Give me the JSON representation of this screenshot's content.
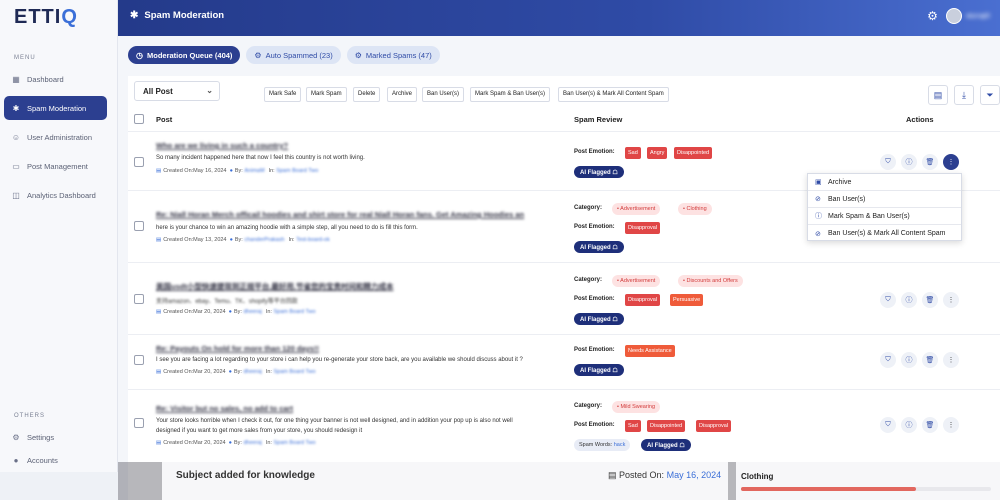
{
  "app": {
    "logo_text": "ETTI",
    "logo_accent": "Q",
    "brand_color": "#2c3f90"
  },
  "sidebar": {
    "menu_label": "MENU",
    "items": [
      {
        "label": "Dashboard",
        "icon": "dashboard-icon"
      },
      {
        "label": "Spam Moderation",
        "icon": "bug-icon",
        "active": true
      },
      {
        "label": "User Administration",
        "icon": "users-icon"
      },
      {
        "label": "Post Management",
        "icon": "post-icon"
      },
      {
        "label": "Analytics Dashboard",
        "icon": "analytics-icon"
      }
    ],
    "others_label": "OTHERS",
    "others": [
      {
        "label": "Settings",
        "icon": "gear-icon"
      },
      {
        "label": "Accounts",
        "icon": "person-icon"
      }
    ]
  },
  "header": {
    "title": "Spam Moderation",
    "username": "sbzrajl0"
  },
  "tabs": [
    {
      "label": "Moderation Queue (404)",
      "active": true
    },
    {
      "label": "Auto Spammed (23)"
    },
    {
      "label": "Marked Spams (47)"
    }
  ],
  "toolbar": {
    "filter_select": "All Post",
    "actions": [
      "Mark Safe",
      "Mark Spam",
      "Delete",
      "Archive",
      "Ban User(s)",
      "Mark Spam & Ban User(s)",
      "Ban User(s) & Mark All Content Spam"
    ]
  },
  "table": {
    "headers": {
      "post": "Post",
      "review": "Spam Review",
      "actions": "Actions"
    },
    "rows": [
      {
        "title": "Who are we living in such a country?",
        "body": "So many incident happened here that now I feel this country is not worth living.",
        "created": "Created On:May 16, 2024",
        "by_label": "By:",
        "by": "AnimaM",
        "in_label": "In:",
        "board": "Spam Board Two",
        "emotion_label": "Post Emotion:",
        "emotions": [
          "Sad",
          "Angry",
          "Disappointed"
        ],
        "ai": "AI Flagged"
      },
      {
        "title": "Re: Niall Horan Merch officail hoodies and shirt store for real Niall Horan fans. Get Amazing Hoodies an",
        "body": "here is your chance to win an amazing hoodie with a simple step, all you need to do is fill this form.",
        "created": "Created On:May 13, 2024",
        "by_label": "By:",
        "by": "chanderPrakash",
        "in_label": "In:",
        "board": "Test-board-ok",
        "category_label": "Category:",
        "categories": [
          "Advertisement",
          "Clothing"
        ],
        "emotion_label": "Post Emotion:",
        "emotions": [
          "Disapproval"
        ],
        "ai": "AI Flagged"
      },
      {
        "title": "美国usdt小型快速提现到正规平台,最好用,节省您的宝贵时间和精力成本",
        "body": "支持amazon、ebay、Temu、TK、shopify等平台回款",
        "created": "Created On:Mar 20, 2024",
        "by_label": "By:",
        "by": "dheeraj",
        "in_label": "In:",
        "board": "Spam Board Two",
        "category_label": "Category:",
        "categories": [
          "Advertisement",
          "Discounts and Offers"
        ],
        "emotion_label": "Post Emotion:",
        "emotions": [
          "Disapproval",
          "Persuasive"
        ],
        "ai": "AI Flagged"
      },
      {
        "title": "Re: Payouts On hold for more than 120 days!!",
        "body": "I see you are facing a lot regarding to your store i can help you re-generate your store back, are you available we should discuss about it ?",
        "created": "Created On:Mar 20, 2024",
        "by_label": "By:",
        "by": "dheeraj",
        "in_label": "In:",
        "board": "Spam Board Two",
        "emotion_label": "Post Emotion:",
        "emotions": [
          "Needs Assistance"
        ],
        "ai": "AI Flagged"
      },
      {
        "title": "Re: Visitor but no sales, no add to cart",
        "body": "Your store looks horrible when I check it out, for one thing your banner is not well designed, and in addition your pop up is also not well",
        "body2": "designed if you want to get more sales from your store, you should redesign it",
        "created": "Created On:Mar 20, 2024",
        "by_label": "By:",
        "by": "dheeraj",
        "in_label": "In:",
        "board": "Spam Board Two",
        "category_label": "Category:",
        "categories": [
          "Mild Swearing"
        ],
        "emotion_label": "Post Emotion:",
        "emotions": [
          "Sad",
          "Disappointed",
          "Disapproval"
        ],
        "spam_words_label": "Spam Words:",
        "spam_words": "hack",
        "ai": "AI Flagged"
      }
    ]
  },
  "row_menu": [
    "Archive",
    "Ban User(s)",
    "Mark Spam & Ban User(s)",
    "Ban User(s) & Mark All Content Spam"
  ],
  "overlay": {
    "subject": "Subject added for knowledge",
    "posted_label": "Posted On:",
    "posted_date": "May 16, 2024",
    "category": "Clothing",
    "category_fill": 0.7
  }
}
